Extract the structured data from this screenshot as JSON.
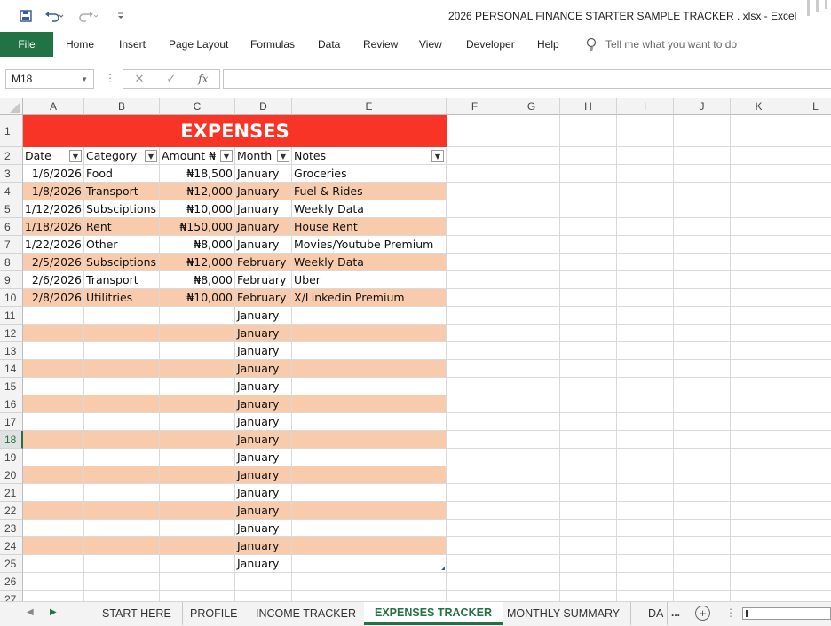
{
  "window": {
    "title": "2026 PERSONAL FINANCE STARTER SAMPLE TRACKER . xlsx  -  Excel"
  },
  "quick_access": {
    "save_icon": "save-icon",
    "undo_icon": "undo-icon",
    "redo_icon": "redo-icon",
    "customize_icon": "customize-icon"
  },
  "ribbon": {
    "file_label": "File",
    "tabs": [
      "Home",
      "Insert",
      "Page Layout",
      "Formulas",
      "Data",
      "Review",
      "View",
      "Developer",
      "Help"
    ],
    "tell_me": "Tell me what you want to do"
  },
  "formula_bar": {
    "name_box": "M18",
    "fx_label": "fx",
    "value": ""
  },
  "columns": [
    "A",
    "B",
    "C",
    "D",
    "E",
    "F",
    "G",
    "H",
    "I",
    "J",
    "K",
    "L"
  ],
  "row_numbers": [
    "1",
    "2",
    "3",
    "4",
    "5",
    "6",
    "7",
    "8",
    "9",
    "10",
    "11",
    "12",
    "13",
    "14",
    "15",
    "16",
    "17",
    "18",
    "19",
    "20",
    "21",
    "22",
    "23",
    "24",
    "25",
    "26",
    "27"
  ],
  "selected_row": "18",
  "table": {
    "banner": "EXPENSES",
    "headers": [
      "Date",
      "Category",
      "Amount ₦",
      "Month",
      "Notes"
    ],
    "rows": [
      [
        "1/6/2026",
        "Food",
        "₦18,500",
        "January",
        "Groceries"
      ],
      [
        "1/8/2026",
        "Transport",
        "₦12,000",
        "January",
        "Fuel & Rides"
      ],
      [
        "1/12/2026",
        "Subsciptions",
        "₦10,000",
        "January",
        "Weekly Data"
      ],
      [
        "1/18/2026",
        "Rent",
        "₦150,000",
        "January",
        "House Rent"
      ],
      [
        "1/22/2026",
        "Other",
        "₦8,000",
        "January",
        "Movies/Youtube Premium"
      ],
      [
        "2/5/2026",
        "Subsciptions",
        "₦12,000",
        "February",
        "Weekly Data"
      ],
      [
        "2/6/2026",
        "Transport",
        "₦8,000",
        "February",
        "Uber"
      ],
      [
        "2/8/2026",
        "Utilitries",
        "₦10,000",
        "February",
        "X/Linkedin Premium"
      ],
      [
        "",
        "",
        "",
        "January",
        ""
      ],
      [
        "",
        "",
        "",
        "January",
        ""
      ],
      [
        "",
        "",
        "",
        "January",
        ""
      ],
      [
        "",
        "",
        "",
        "January",
        ""
      ],
      [
        "",
        "",
        "",
        "January",
        ""
      ],
      [
        "",
        "",
        "",
        "January",
        ""
      ],
      [
        "",
        "",
        "",
        "January",
        ""
      ],
      [
        "",
        "",
        "",
        "January",
        ""
      ],
      [
        "",
        "",
        "",
        "January",
        ""
      ],
      [
        "",
        "",
        "",
        "January",
        ""
      ],
      [
        "",
        "",
        "",
        "January",
        ""
      ],
      [
        "",
        "",
        "",
        "January",
        ""
      ],
      [
        "",
        "",
        "",
        "January",
        ""
      ],
      [
        "",
        "",
        "",
        "January",
        ""
      ],
      [
        "",
        "",
        "",
        "January",
        ""
      ]
    ]
  },
  "colors": {
    "banner": "#f83426",
    "band": "#f8cbad",
    "accent": "#217346"
  },
  "sheets": {
    "tabs": [
      "START HERE",
      "PROFILE",
      "INCOME TRACKER",
      "EXPENSES TRACKER",
      "MONTHLY SUMMARY",
      "DA"
    ],
    "active": "EXPENSES TRACKER",
    "more": "..."
  }
}
